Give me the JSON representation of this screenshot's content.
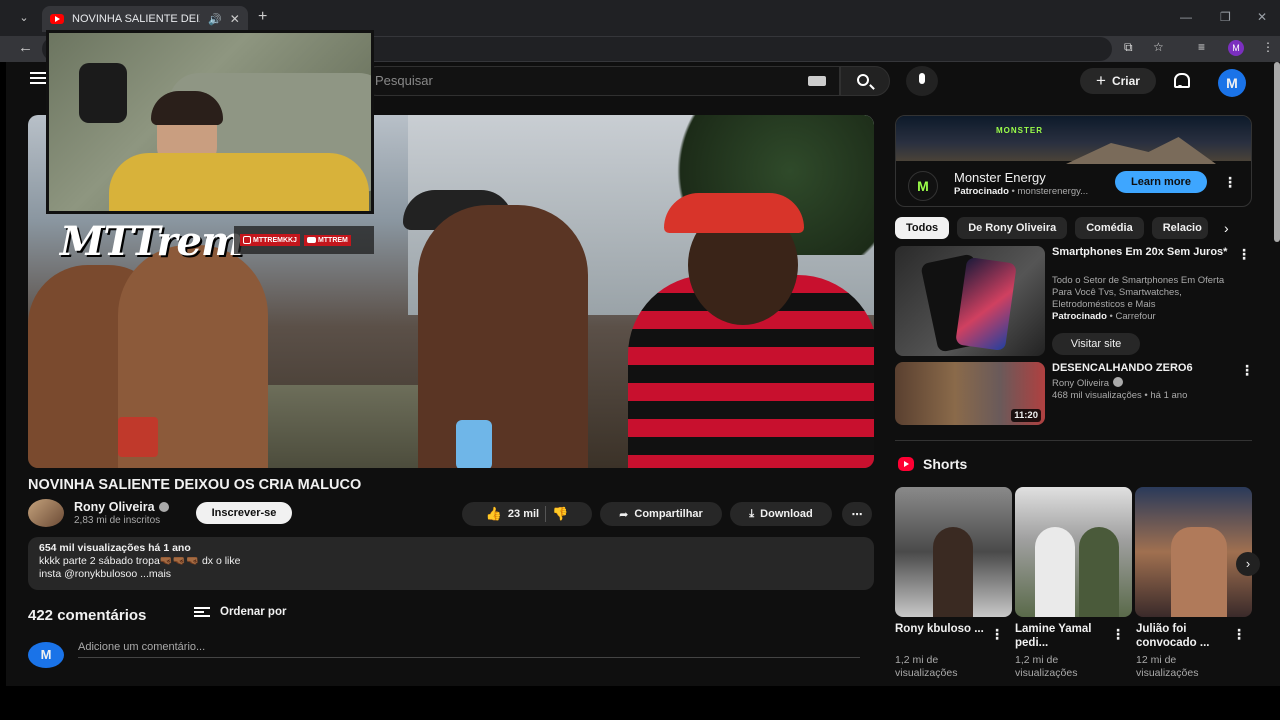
{
  "browser": {
    "tab_title": "NOVINHA SALIENTE DEIXOU",
    "avatar_letter": "M"
  },
  "header": {
    "search_placeholder": "Pesquisar",
    "create_label": "Criar",
    "avatar_letter": "M"
  },
  "overlay": {
    "logo_text": "MTTrem",
    "social_ig": "MTTREMKKJ",
    "social_yt": "MTTREM"
  },
  "video": {
    "title": "NOVINHA SALIENTE DEIXOU OS CRIA MALUCO",
    "channel": "Rony Oliveira",
    "subscribers": "2,83 mi de inscritos",
    "subscribe_label": "Inscrever-se",
    "likes": "23 mil",
    "share_label": "Compartilhar",
    "download_label": "Download",
    "desc_meta": "654 mil visualizações  há 1 ano",
    "desc_line1": "kkkk parte 2 sábado tropa🤜🏾🤜🏾🤜🏾 dx o like",
    "desc_line2": "insta @ronykbulosoo ...mais"
  },
  "comments": {
    "count_label": "422 comentários",
    "sort_label": "Ordenar por",
    "add_placeholder": "Adicione um comentário...",
    "avatar_letter": "M"
  },
  "sidebar": {
    "ad": {
      "banner_logo": "MONSTER",
      "brand_icon": "M",
      "name": "Monster Energy",
      "sponsored": "Patrocinado",
      "domain": " • monsterenergy...",
      "cta": "Learn more"
    },
    "chips": [
      "Todos",
      "De Rony Oliveira",
      "Comédia",
      "Relacio"
    ],
    "promo": {
      "title": "Smartphones Em 20x Sem Juros*",
      "desc": "Todo o Setor de Smartphones Em Oferta Para Você Tvs, Smartwatches, Eletrodomésticos e Mais",
      "sponsored": "Patrocinado",
      "advertiser": " • Carrefour",
      "cta": "Visitar site"
    },
    "related": {
      "title": "DESENCALHANDO ZERO6",
      "channel": "Rony Oliveira",
      "meta": "468 mil visualizações • há 1 ano",
      "duration": "11:20"
    },
    "shorts_label": "Shorts",
    "shorts": [
      {
        "title": "Rony kbuloso ...",
        "views": "1,2 mi de visualizações"
      },
      {
        "title": "Lamine Yamal pedi...",
        "views": "1,2 mi de visualizações"
      },
      {
        "title": "Julião foi convocado ...",
        "views": "12 mi de visualizações"
      }
    ]
  }
}
